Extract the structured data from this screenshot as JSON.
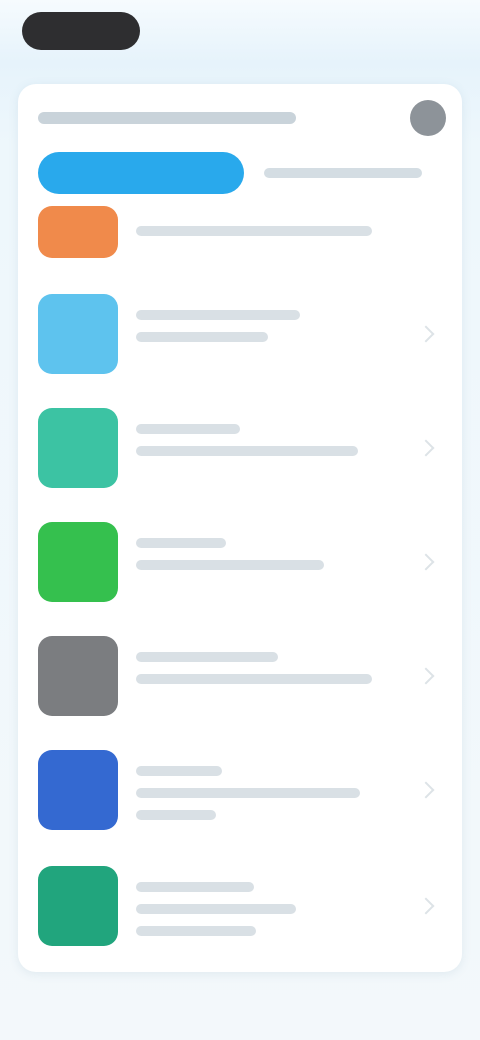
{
  "header": {
    "avatar": "avatar-icon"
  },
  "progress": {
    "fraction": 0.5
  },
  "list": {
    "items": [
      {
        "icon": "app-icon",
        "color": "#f08a4b"
      },
      {
        "icon": "app-icon",
        "color": "#5ec3ee"
      },
      {
        "icon": "app-icon",
        "color": "#3cc3a3"
      },
      {
        "icon": "app-icon",
        "color": "#35c04e"
      },
      {
        "icon": "app-icon",
        "color": "#7b7d80"
      },
      {
        "icon": "app-icon",
        "color": "#3469d1"
      },
      {
        "icon": "app-icon",
        "color": "#21a57d"
      }
    ]
  },
  "colors": {
    "accent": "#29a9ec",
    "background": "#e9f4fb",
    "panel": "#ffffff"
  }
}
